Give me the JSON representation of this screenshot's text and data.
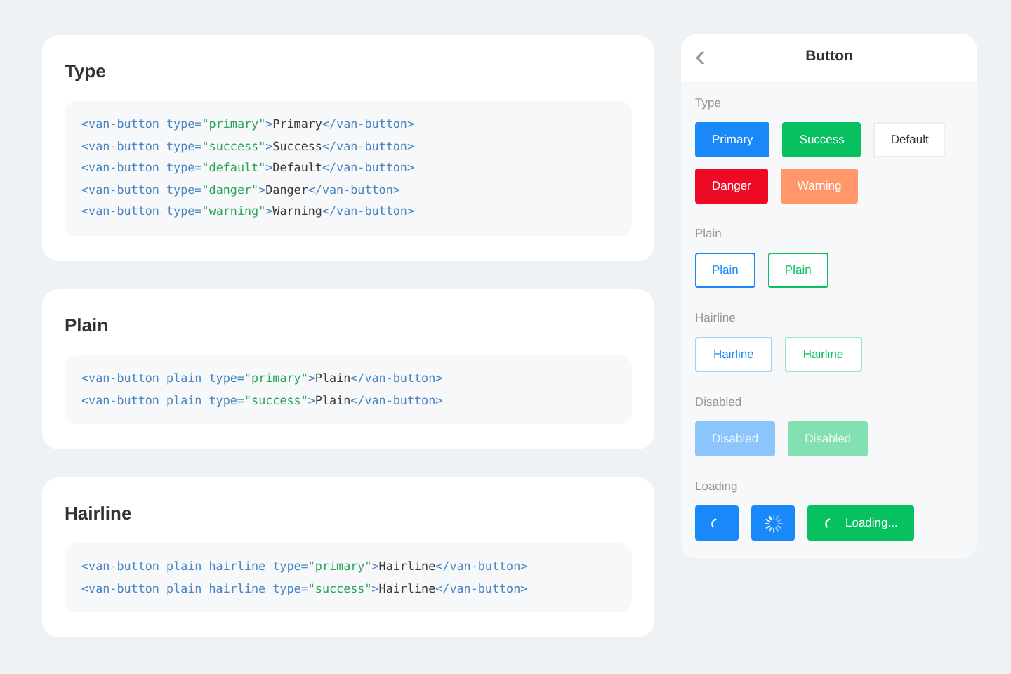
{
  "doc_cards": [
    {
      "title": "Type",
      "code": [
        [
          {
            "kind": "tag",
            "text": "<van-button"
          },
          {
            "kind": "attr",
            "text": " type="
          },
          {
            "kind": "value",
            "text": "\"primary\""
          },
          {
            "kind": "tag",
            "text": ">"
          },
          {
            "kind": "text",
            "text": "Primary"
          },
          {
            "kind": "tag",
            "text": "</van-button>"
          }
        ],
        [
          {
            "kind": "tag",
            "text": "<van-button"
          },
          {
            "kind": "attr",
            "text": " type="
          },
          {
            "kind": "value",
            "text": "\"success\""
          },
          {
            "kind": "tag",
            "text": ">"
          },
          {
            "kind": "text",
            "text": "Success"
          },
          {
            "kind": "tag",
            "text": "</van-button>"
          }
        ],
        [
          {
            "kind": "tag",
            "text": "<van-button"
          },
          {
            "kind": "attr",
            "text": " type="
          },
          {
            "kind": "value",
            "text": "\"default\""
          },
          {
            "kind": "tag",
            "text": ">"
          },
          {
            "kind": "text",
            "text": "Default"
          },
          {
            "kind": "tag",
            "text": "</van-button>"
          }
        ],
        [
          {
            "kind": "tag",
            "text": "<van-button"
          },
          {
            "kind": "attr",
            "text": " type="
          },
          {
            "kind": "value",
            "text": "\"danger\""
          },
          {
            "kind": "tag",
            "text": ">"
          },
          {
            "kind": "text",
            "text": "Danger"
          },
          {
            "kind": "tag",
            "text": "</van-button>"
          }
        ],
        [
          {
            "kind": "tag",
            "text": "<van-button"
          },
          {
            "kind": "attr",
            "text": " type="
          },
          {
            "kind": "value",
            "text": "\"warning\""
          },
          {
            "kind": "tag",
            "text": ">"
          },
          {
            "kind": "text",
            "text": "Warning"
          },
          {
            "kind": "tag",
            "text": "</van-button>"
          }
        ]
      ]
    },
    {
      "title": "Plain",
      "code": [
        [
          {
            "kind": "tag",
            "text": "<van-button"
          },
          {
            "kind": "attr",
            "text": " plain type="
          },
          {
            "kind": "value",
            "text": "\"primary\""
          },
          {
            "kind": "tag",
            "text": ">"
          },
          {
            "kind": "text",
            "text": "Plain"
          },
          {
            "kind": "tag",
            "text": "</van-button>"
          }
        ],
        [
          {
            "kind": "tag",
            "text": "<van-button"
          },
          {
            "kind": "attr",
            "text": " plain type="
          },
          {
            "kind": "value",
            "text": "\"success\""
          },
          {
            "kind": "tag",
            "text": ">"
          },
          {
            "kind": "text",
            "text": "Plain"
          },
          {
            "kind": "tag",
            "text": "</van-button>"
          }
        ]
      ]
    },
    {
      "title": "Hairline",
      "code": [
        [
          {
            "kind": "tag",
            "text": "<van-button"
          },
          {
            "kind": "attr",
            "text": " plain hairline type="
          },
          {
            "kind": "value",
            "text": "\"primary\""
          },
          {
            "kind": "tag",
            "text": ">"
          },
          {
            "kind": "text",
            "text": "Hairline"
          },
          {
            "kind": "tag",
            "text": "</van-button>"
          }
        ],
        [
          {
            "kind": "tag",
            "text": "<van-button"
          },
          {
            "kind": "attr",
            "text": " plain hairline type="
          },
          {
            "kind": "value",
            "text": "\"success\""
          },
          {
            "kind": "tag",
            "text": ">"
          },
          {
            "kind": "text",
            "text": "Hairline"
          },
          {
            "kind": "tag",
            "text": "</van-button>"
          }
        ]
      ]
    }
  ],
  "phone": {
    "back": "‹",
    "title": "Button",
    "sections": [
      {
        "title": "Type",
        "buttons": [
          {
            "kind": "solid",
            "color": "#1989fa",
            "disabled": false,
            "label": "Primary"
          },
          {
            "kind": "solid",
            "color": "#07c160",
            "disabled": false,
            "label": "Success"
          },
          {
            "kind": "outline",
            "color": "#ebedf0",
            "disabled": false,
            "label": "Default"
          },
          {
            "kind": "solid",
            "color": "#ee0a24",
            "disabled": false,
            "label": "Danger"
          },
          {
            "kind": "solid",
            "color": "#ff976a",
            "disabled": false,
            "label": "Warning"
          }
        ]
      },
      {
        "title": "Plain",
        "buttons": [
          {
            "kind": "plain",
            "color": "#1989fa",
            "disabled": false,
            "label": "Plain"
          },
          {
            "kind": "plain",
            "color": "#07c160",
            "disabled": false,
            "label": "Plain"
          }
        ]
      },
      {
        "title": "Hairline",
        "buttons": [
          {
            "kind": "hairline",
            "color": "#1989fa",
            "disabled": false,
            "label": "Hairline"
          },
          {
            "kind": "hairline",
            "color": "#07c160",
            "disabled": false,
            "label": "Hairline"
          }
        ]
      },
      {
        "title": "Disabled",
        "buttons": [
          {
            "kind": "solid",
            "color": "#8cc4fc",
            "disabled": true,
            "label": "Disabled"
          },
          {
            "kind": "solid",
            "color": "#83e0b0",
            "disabled": true,
            "label": "Disabled"
          }
        ]
      },
      {
        "title": "Loading",
        "buttons": [
          {
            "kind": "loading",
            "color": "#1989fa",
            "disabled": false
          },
          {
            "kind": "spinner",
            "color": "#1989fa",
            "disabled": false
          },
          {
            "kind": "loading",
            "color": "#07c160",
            "disabled": false,
            "label": "Loading..."
          }
        ]
      }
    ]
  }
}
